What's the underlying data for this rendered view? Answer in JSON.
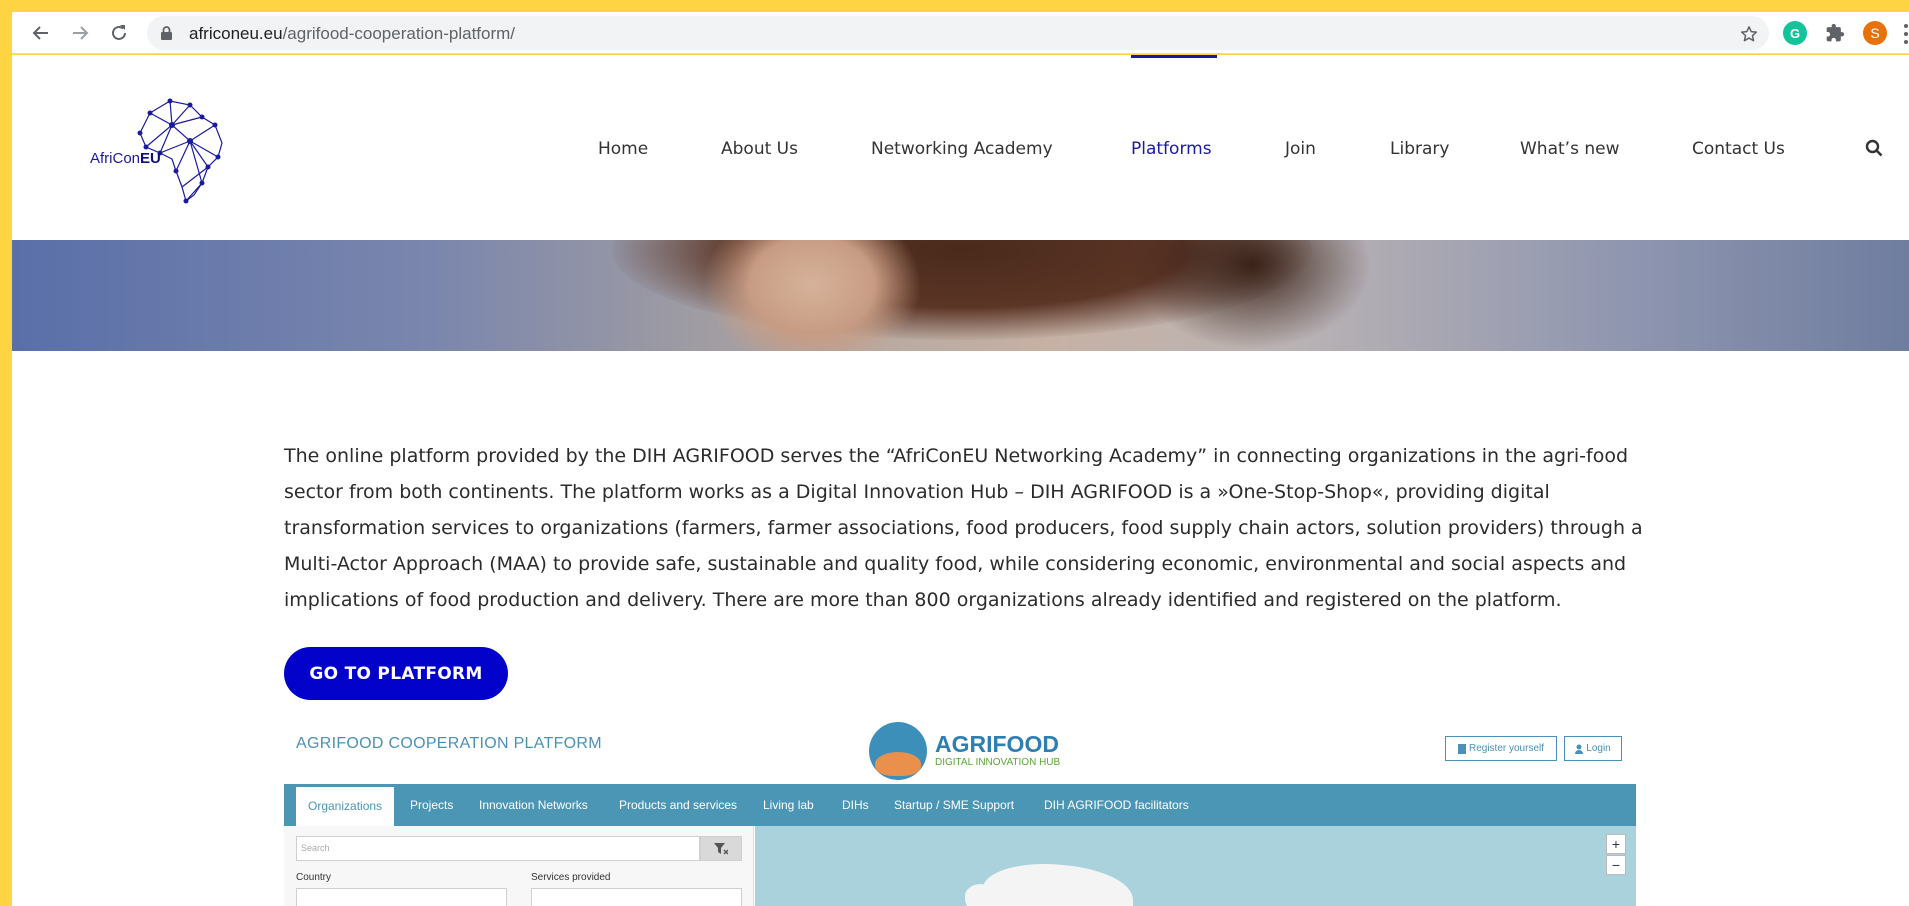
{
  "browser": {
    "url_host": "africoneu.eu",
    "url_path": "/agrifood-cooperation-platform/",
    "profile_initial": "S",
    "extension_initial": "G",
    "icons": [
      "back-arrow-icon",
      "forward-arrow-icon",
      "reload-icon",
      "lock-icon",
      "star-icon",
      "grammarly-icon",
      "puzzle-piece-icon",
      "more-vertical-icon"
    ],
    "colors": {
      "frame": "#fed442",
      "profile": "#e8710a",
      "grammarly": "#15c39a"
    }
  },
  "site": {
    "logo": {
      "prefix": "AfriCon",
      "suffix": "EU"
    },
    "nav": {
      "items": [
        {
          "label": "Home"
        },
        {
          "label": "About Us"
        },
        {
          "label": "Networking Academy"
        },
        {
          "label": "Platforms",
          "active": true
        },
        {
          "label": "Join"
        },
        {
          "label": "Library"
        },
        {
          "label": "What’s new"
        },
        {
          "label": "Contact Us"
        }
      ],
      "search_icon": "search-icon"
    },
    "colors": {
      "accent": "#1919a4",
      "cta": "#0202cb",
      "text": "#2b2b2b"
    }
  },
  "content": {
    "intro": "The online platform provided by the DIH AGRIFOOD serves the “AfriConEU Networking Academy” in connecting organizations in the agri-food sector from both continents. The platform works as a Digital Innovation Hub – DIH AGRIFOOD is a »One-Stop-Shop«, providing digital transformation services to organizations (farmers, farmer associations, food producers, food supply chain actors, solution providers) through a Multi-Actor Approach (MAA) to provide safe, sustainable and quality food, while considering economic, environmental and social aspects and implications of food production and delivery. There are more than 800 organizations already identified and registered on the platform.",
    "cta_label": "GO TO PLATFORM"
  },
  "preview": {
    "title": "AGRIFOOD COOPERATION PLATFORM",
    "brand": "AGRIFOOD",
    "tagline": "DIGITAL INNOVATION HUB",
    "register_label": "Register yourself",
    "login_label": "Login",
    "tabs": [
      {
        "label": "Organizations",
        "active": true
      },
      {
        "label": "Projects"
      },
      {
        "label": "Innovation Networks"
      },
      {
        "label": "Products and services"
      },
      {
        "label": "Living lab"
      },
      {
        "label": "DIHs"
      },
      {
        "label": "Startup / SME Support"
      },
      {
        "label": "DIH AGRIFOOD facilitators"
      }
    ],
    "search_placeholder": "Search",
    "country_label": "Country",
    "services_label": "Services provided",
    "zoom_in": "+",
    "zoom_out": "−",
    "colors": {
      "tab_bar": "#4b95b5",
      "map_water": "#a9d2dd",
      "title": "#4a90b8",
      "tagline": "#5aa830"
    }
  }
}
